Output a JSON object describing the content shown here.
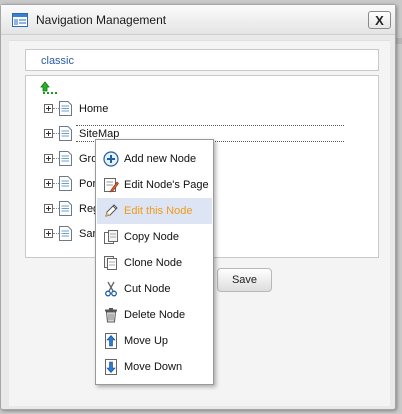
{
  "window": {
    "title": "Navigation Management",
    "close_label": "X"
  },
  "site": {
    "name": "classic"
  },
  "tree": {
    "nodes": [
      {
        "label": "Home"
      },
      {
        "label": "SiteMap"
      },
      {
        "label": "Gro"
      },
      {
        "label": "Por"
      },
      {
        "label": "Reg"
      },
      {
        "label": "San"
      }
    ]
  },
  "footer": {
    "save_label": "Save"
  },
  "context_menu": {
    "items": [
      {
        "label": "Add new Node",
        "icon": "add-icon"
      },
      {
        "label": "Edit Node's Page",
        "icon": "edit-page-icon"
      },
      {
        "label": "Edit this Node",
        "icon": "pencil-icon"
      },
      {
        "label": "Copy Node",
        "icon": "copy-icon"
      },
      {
        "label": "Clone Node",
        "icon": "clone-icon"
      },
      {
        "label": "Cut Node",
        "icon": "scissors-icon"
      },
      {
        "label": "Delete Node",
        "icon": "trash-icon"
      },
      {
        "label": "Move Up",
        "icon": "arrow-up-icon"
      },
      {
        "label": "Move Down",
        "icon": "arrow-down-icon"
      }
    ],
    "hover_color": "#f09a1a"
  },
  "colors": {
    "accent": "#2a5aa8",
    "root_icon": "#1a9a1a"
  }
}
